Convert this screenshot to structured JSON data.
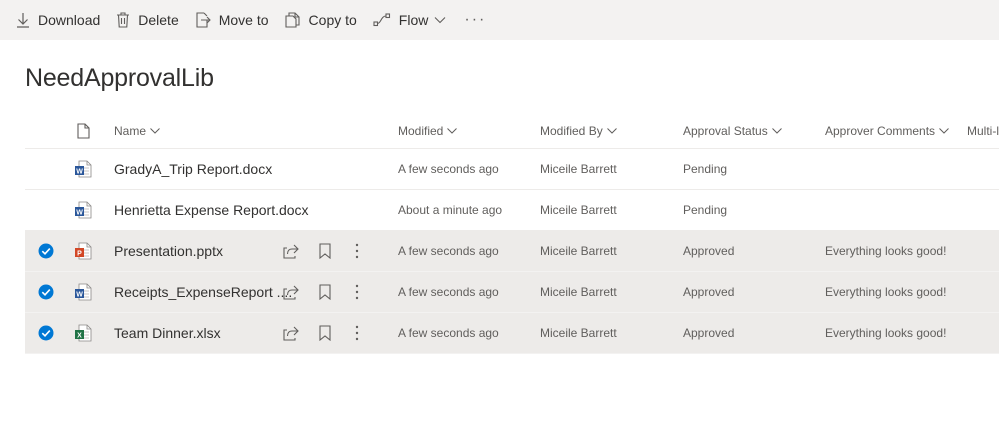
{
  "toolbar": {
    "download": "Download",
    "delete": "Delete",
    "move_to": "Move to",
    "copy_to": "Copy to",
    "flow": "Flow",
    "more": "···"
  },
  "library_title": "NeedApprovalLib",
  "columns": {
    "name": "Name",
    "modified": "Modified",
    "modified_by": "Modified By",
    "approval_status": "Approval Status",
    "approver_comments": "Approver Comments",
    "multi": "Multi-l"
  },
  "files": [
    {
      "name": "GradyA_Trip Report.docx",
      "type": "word",
      "modified": "A few seconds ago",
      "modified_by": "Miceile Barrett",
      "status": "Pending",
      "comments": "",
      "selected": false
    },
    {
      "name": "Henrietta Expense Report.docx",
      "type": "word",
      "modified": "About a minute ago",
      "modified_by": "Miceile Barrett",
      "status": "Pending",
      "comments": "",
      "selected": false
    },
    {
      "name": "Presentation.pptx",
      "type": "powerpoint",
      "modified": "A few seconds ago",
      "modified_by": "Miceile Barrett",
      "status": "Approved",
      "comments": "Everything looks good!",
      "selected": true
    },
    {
      "name": "Receipts_ExpenseReport ....",
      "type": "word",
      "modified": "A few seconds ago",
      "modified_by": "Miceile Barrett",
      "status": "Approved",
      "comments": "Everything looks good!",
      "selected": true
    },
    {
      "name": "Team Dinner.xlsx",
      "type": "excel",
      "modified": "A few seconds ago",
      "modified_by": "Miceile Barrett",
      "status": "Approved",
      "comments": "Everything looks good!",
      "selected": true
    }
  ],
  "colors": {
    "word": "#2b579a",
    "powerpoint": "#d24726",
    "excel": "#217346",
    "check": "#0078d4"
  }
}
